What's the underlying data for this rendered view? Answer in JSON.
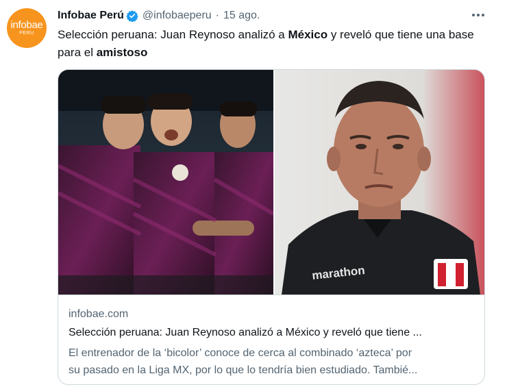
{
  "tweet": {
    "avatar": {
      "brand": "infobae",
      "sub": "PERU"
    },
    "author_name": "Infobae Perú",
    "handle": "@infobaeperu",
    "separator": "·",
    "date": "15 ago.",
    "text": {
      "part1": "Selección peruana: Juan Reynoso analizó a ",
      "bold1": "México",
      "part2": " y reveló que tiene una base para el ",
      "bold2": "amistoso"
    },
    "card": {
      "domain": "infobae.com",
      "title": "Selección peruana: Juan Reynoso analizó a México y reveló que tiene ...",
      "description_line1": "El entrenador de la ‘bicolor’ conoce de cerca al combinado ‘azteca’ por",
      "description_line2": "su pasado en la Liga MX, por lo que lo tendría bien estudiado. Tambié...",
      "shirt_brand": "marathon"
    }
  },
  "colors": {
    "brand_orange": "#f7941d",
    "verified_blue": "#1d9bf0",
    "secondary_text": "#536471",
    "border": "#cfd9de"
  },
  "icons": [
    "verified-badge-icon",
    "more-options-icon"
  ]
}
